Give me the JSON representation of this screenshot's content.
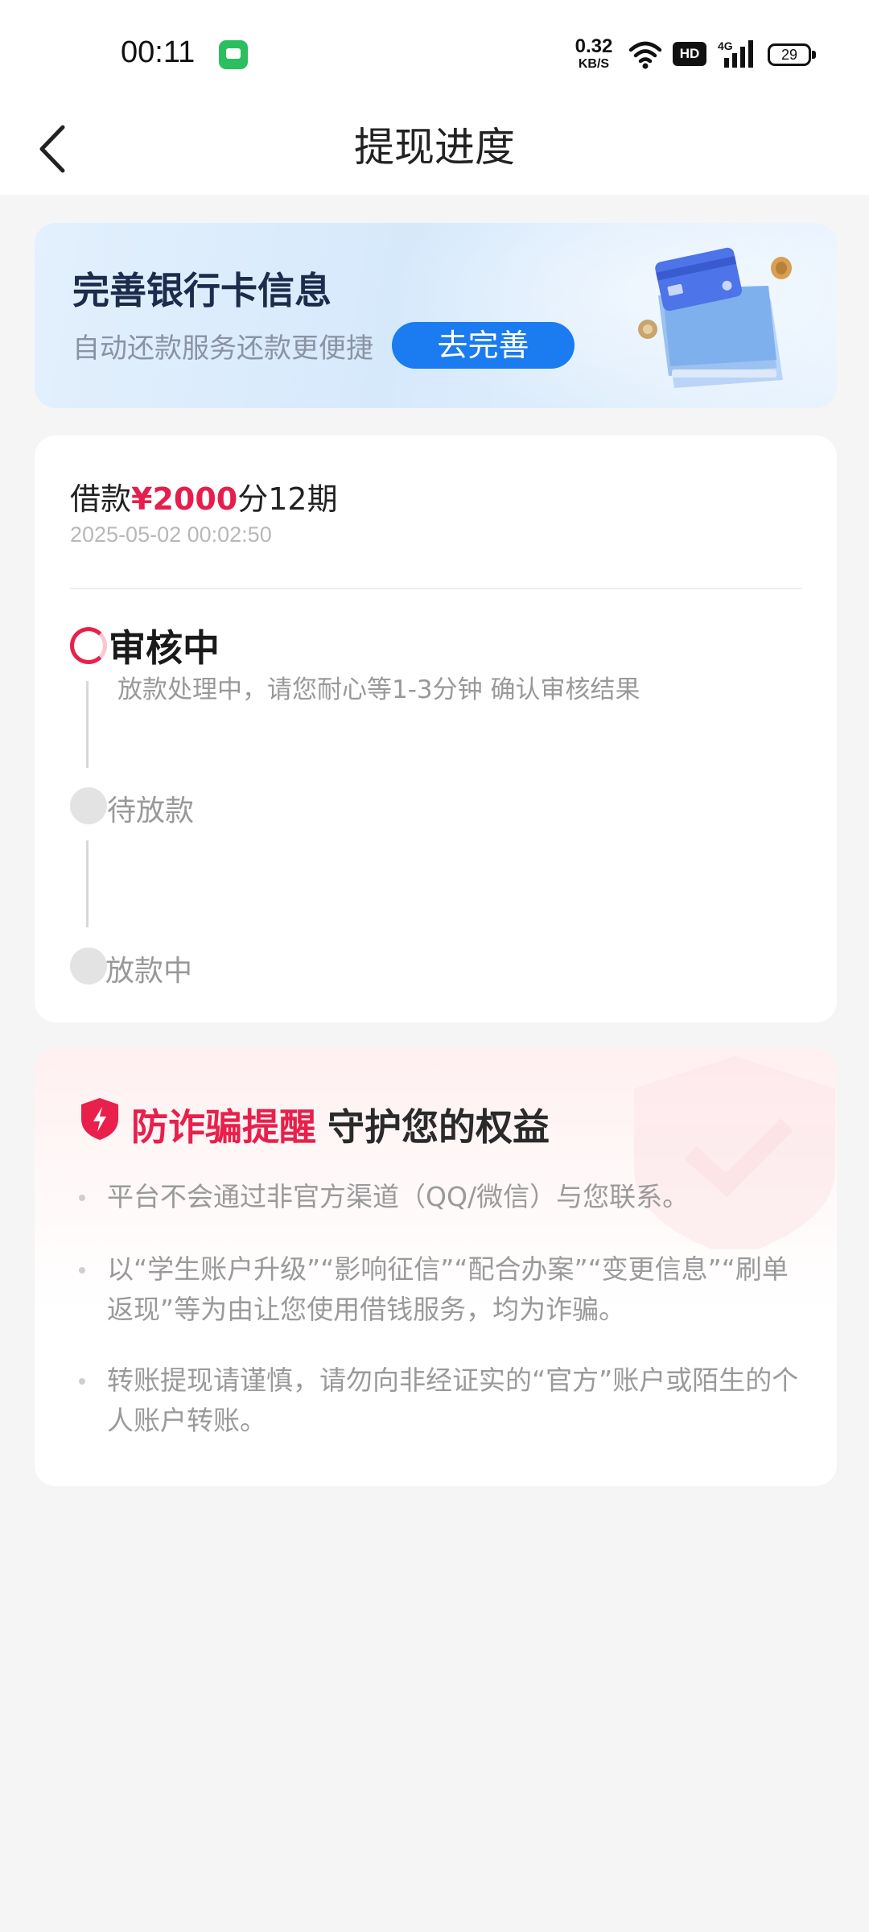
{
  "status_bar": {
    "time": "00:11",
    "net_speed_value": "0.32",
    "net_speed_unit": "KB/S",
    "hd_label": "HD",
    "network_label": "4G",
    "battery": "29"
  },
  "header": {
    "title": "提现进度"
  },
  "banner": {
    "title": "完善银行卡信息",
    "subtitle": "自动还款服务还款更便捷",
    "button_label": "去完善"
  },
  "loan": {
    "prefix": "借款",
    "amount": "¥2000",
    "suffix": "分12期",
    "timestamp": "2025-05-02 00:02:50"
  },
  "progress": {
    "steps": [
      {
        "label": "审核中",
        "desc": "放款处理中，请您耐心等1-3分钟 确认审核结果",
        "status": "active"
      },
      {
        "label": "待放款",
        "status": "pending"
      },
      {
        "label": "放款中",
        "status": "pending"
      }
    ]
  },
  "fraud_notice": {
    "title_red": "防诈骗提醒",
    "title_dark": "守护您的权益",
    "items": [
      "平台不会通过非官方渠道（QQ/微信）与您联系。",
      "以“学生账户升级”“影响征信”“配合办案”“变更信息”“刷单返现”等为由让您使用借钱服务，均为诈骗。",
      "转账提现请谨慎，请勿向非经证实的“官方”账户或陌生的个人账户转账。"
    ]
  },
  "colors": {
    "accent_red": "#e8204b",
    "accent_blue": "#1a7cf0",
    "page_bg": "#f5f5f5"
  },
  "icons": {
    "back": "chevron-left-icon",
    "shield": "shield-bolt-icon",
    "message": "message-app-icon",
    "wifi": "wifi-icon",
    "signal": "signal-icon",
    "battery": "battery-icon"
  }
}
